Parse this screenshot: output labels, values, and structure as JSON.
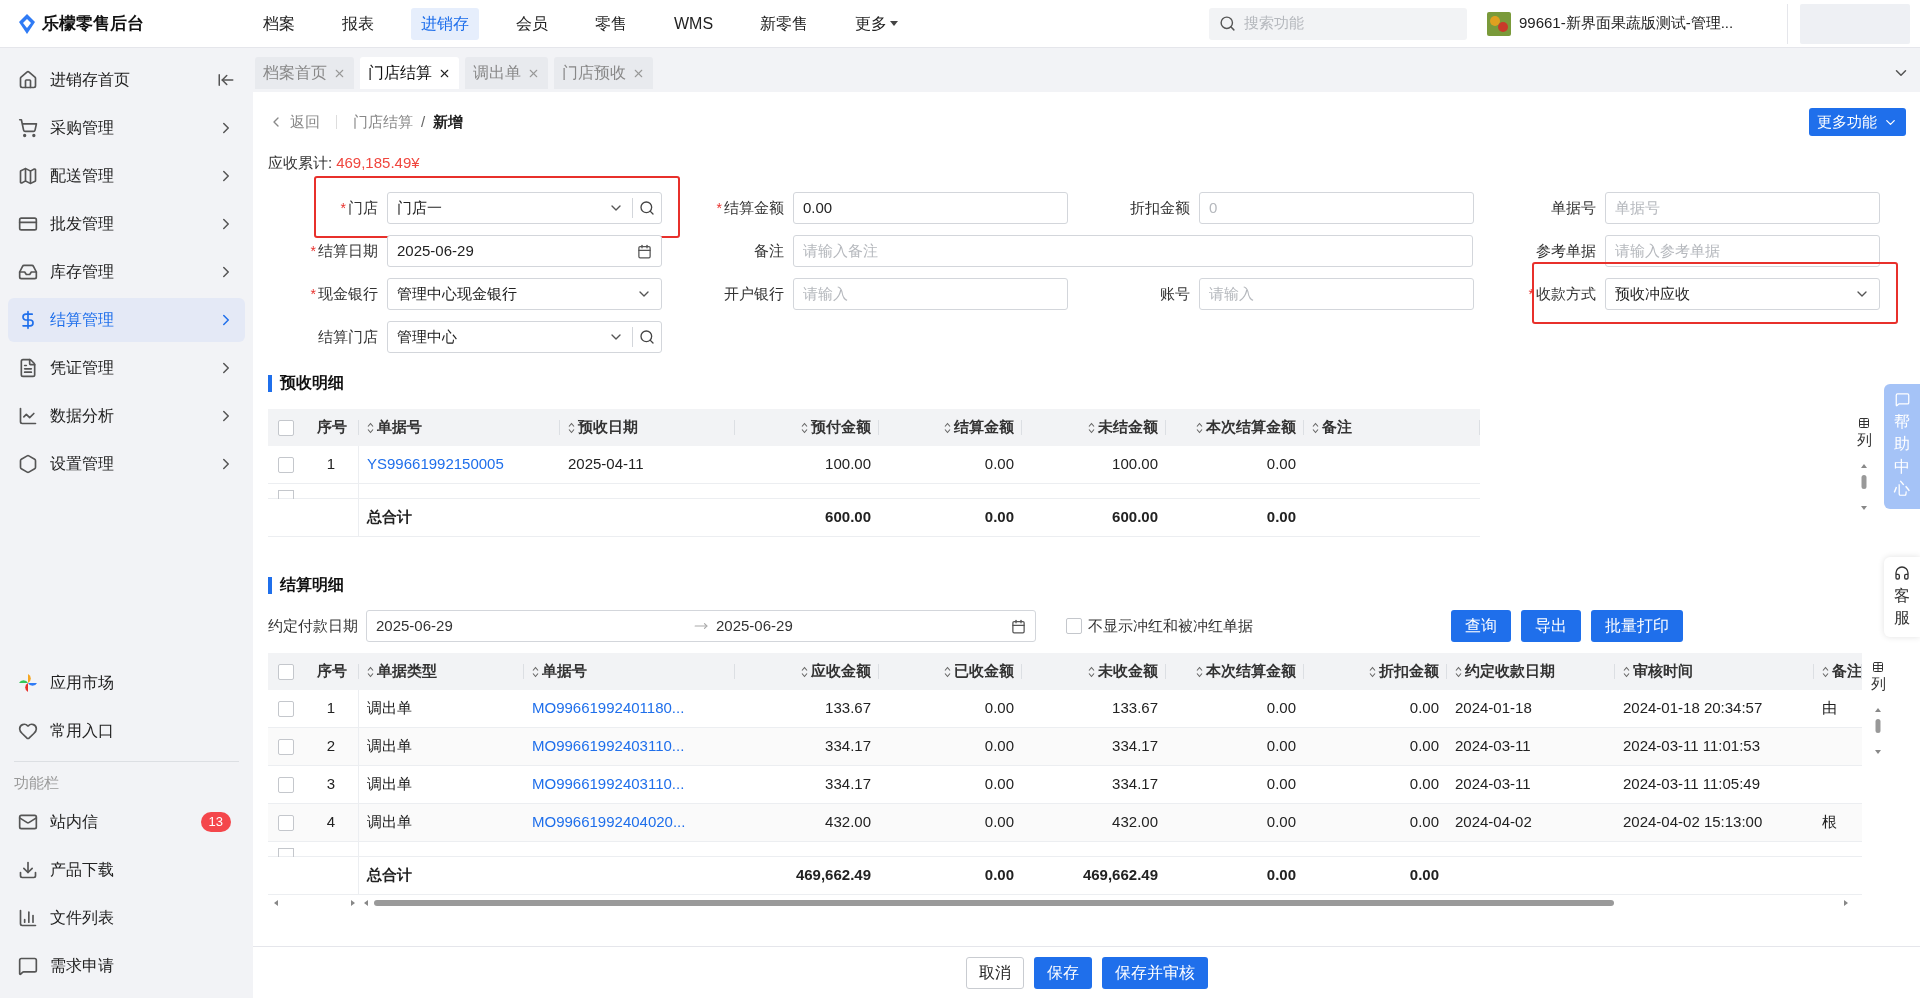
{
  "app": {
    "title": "乐檬零售后台"
  },
  "top_nav": [
    {
      "label": "档案",
      "selected": false,
      "dropdown": false
    },
    {
      "label": "报表",
      "selected": false,
      "dropdown": false
    },
    {
      "label": "进销存",
      "selected": true,
      "dropdown": false
    },
    {
      "label": "会员",
      "selected": false,
      "dropdown": false
    },
    {
      "label": "零售",
      "selected": false,
      "dropdown": false
    },
    {
      "label": "WMS",
      "selected": false,
      "dropdown": false
    },
    {
      "label": "新零售",
      "selected": false,
      "dropdown": false
    },
    {
      "label": "更多",
      "selected": false,
      "dropdown": true
    }
  ],
  "search": {
    "placeholder": "搜索功能"
  },
  "store": {
    "name": "99661-新界面果蔬版测试-管理..."
  },
  "sidebar": {
    "items": [
      {
        "label": "进销存首页",
        "selected": false,
        "expandable": false
      },
      {
        "label": "采购管理",
        "selected": false,
        "expandable": true
      },
      {
        "label": "配送管理",
        "selected": false,
        "expandable": true
      },
      {
        "label": "批发管理",
        "selected": false,
        "expandable": true
      },
      {
        "label": "库存管理",
        "selected": false,
        "expandable": true
      },
      {
        "label": "结算管理",
        "selected": true,
        "expandable": true
      },
      {
        "label": "凭证管理",
        "selected": false,
        "expandable": true
      },
      {
        "label": "数据分析",
        "selected": false,
        "expandable": true
      },
      {
        "label": "设置管理",
        "selected": false,
        "expandable": true
      }
    ],
    "shortcuts": [
      {
        "label": "应用市场"
      },
      {
        "label": "常用入口"
      }
    ],
    "section_title": "功能栏",
    "tools": [
      {
        "label": "站内信",
        "badge": "13"
      },
      {
        "label": "产品下载"
      },
      {
        "label": "文件列表"
      },
      {
        "label": "需求申请"
      }
    ]
  },
  "tabs": [
    {
      "label": "档案首页",
      "selected": false
    },
    {
      "label": "门店结算",
      "selected": true
    },
    {
      "label": "调出单",
      "selected": false
    },
    {
      "label": "门店预收",
      "selected": false
    }
  ],
  "breadcrumb": {
    "back": "返回",
    "path": [
      {
        "label": "门店结算",
        "current": false
      },
      {
        "label": "新增",
        "current": true
      }
    ],
    "separator": "/"
  },
  "more_button": {
    "label": "更多功能"
  },
  "receivable_total": {
    "label": "应收累计:",
    "value": "469,185.49¥"
  },
  "form": {
    "required_mark": "*",
    "fields": [
      {
        "label": "门店",
        "required": true,
        "kind": "select-search",
        "value": "门店一",
        "highlighted": true,
        "wide": false
      },
      {
        "label": "结算金额",
        "required": true,
        "kind": "text",
        "value": "0.00",
        "highlighted": false,
        "wide": false
      },
      {
        "label": "折扣金额",
        "required": false,
        "kind": "text",
        "placeholder": "0",
        "highlighted": false,
        "wide": false
      },
      {
        "label": "单据号",
        "required": false,
        "kind": "text",
        "placeholder": "单据号",
        "highlighted": false,
        "wide": false
      },
      {
        "label": "结算日期",
        "required": true,
        "kind": "date",
        "value": "2025-06-29",
        "highlighted": false,
        "wide": false
      },
      {
        "label": "备注",
        "required": false,
        "kind": "text",
        "placeholder": "请输入备注",
        "highlighted": false,
        "wide": true
      },
      {
        "label": "参考单据",
        "required": false,
        "kind": "text",
        "placeholder": "请输入参考单据",
        "highlighted": false,
        "wide": false
      },
      {
        "label": "现金银行",
        "required": true,
        "kind": "select",
        "value": "管理中心现金银行",
        "highlighted": false,
        "wide": false
      },
      {
        "label": "开户银行",
        "required": false,
        "kind": "text",
        "placeholder": "请输入",
        "highlighted": false,
        "wide": false
      },
      {
        "label": "账号",
        "required": false,
        "kind": "text",
        "placeholder": "请输入",
        "highlighted": false,
        "wide": false
      },
      {
        "label": "收款方式",
        "required": true,
        "kind": "select",
        "value": "预收冲应收",
        "highlighted": true,
        "wide": false
      },
      {
        "label": "结算门店",
        "required": false,
        "kind": "select-search",
        "value": "管理中心",
        "highlighted": false,
        "wide": false
      }
    ]
  },
  "prepaid_section": {
    "title": "预收明细",
    "column_settings": "列",
    "all_checked": false,
    "total_row": {
      "cells": [
        "",
        "总合计",
        "",
        "600.00",
        "0.00",
        "600.00",
        "0.00"
      ]
    },
    "columns": [
      {
        "label": "序号",
        "sortable": false,
        "kind": "index"
      },
      {
        "label": "单据号",
        "sortable": true,
        "kind": "link"
      },
      {
        "label": "预收日期",
        "sortable": true,
        "kind": "text"
      },
      {
        "label": "预付金额",
        "sortable": true,
        "kind": "number"
      },
      {
        "label": "结算金额",
        "sortable": true,
        "kind": "number"
      },
      {
        "label": "未结金额",
        "sortable": true,
        "kind": "number"
      },
      {
        "label": "本次结算金额",
        "sortable": true,
        "kind": "number"
      },
      {
        "label": "备注",
        "sortable": true,
        "kind": "text"
      }
    ],
    "rows": [
      {
        "checked": false,
        "cells": [
          "1",
          "YS99661992150005",
          "2025-04-11",
          "100.00",
          "0.00",
          "100.00",
          "0.00"
        ]
      }
    ]
  },
  "settlement_section": {
    "title": "结算明细",
    "column_settings": "列",
    "all_checked": false,
    "total_row": {
      "cells": [
        "",
        "总合计",
        "",
        "469,662.49",
        "0.00",
        "469,662.49",
        "0.00",
        "0.00"
      ]
    },
    "filter": {
      "label": "约定付款日期",
      "start": "2025-06-29",
      "end": "2025-06-29",
      "checkbox": {
        "label": "不显示冲红和被冲红单据",
        "checked": false
      },
      "buttons": [
        {
          "label": "查询"
        },
        {
          "label": "导出"
        },
        {
          "label": "批量打印"
        }
      ]
    },
    "columns": [
      {
        "label": "序号",
        "sortable": false,
        "kind": "index"
      },
      {
        "label": "单据类型",
        "sortable": true,
        "kind": "text"
      },
      {
        "label": "单据号",
        "sortable": true,
        "kind": "link"
      },
      {
        "label": "应收金额",
        "sortable": true,
        "kind": "number"
      },
      {
        "label": "已收金额",
        "sortable": true,
        "kind": "number"
      },
      {
        "label": "未收金额",
        "sortable": true,
        "kind": "number"
      },
      {
        "label": "本次结算金额",
        "sortable": true,
        "kind": "number"
      },
      {
        "label": "折扣金额",
        "sortable": true,
        "kind": "number"
      },
      {
        "label": "约定收款日期",
        "sortable": true,
        "kind": "text"
      },
      {
        "label": "审核时间",
        "sortable": true,
        "kind": "text"
      },
      {
        "label": "备注",
        "sortable": true,
        "kind": "text"
      }
    ],
    "rows": [
      {
        "checked": false,
        "cells": [
          "1",
          "调出单",
          "MO99661992401180...",
          "133.67",
          "0.00",
          "133.67",
          "0.00",
          "0.00",
          "2024-01-18",
          "2024-01-18 20:34:57",
          "由"
        ]
      },
      {
        "checked": false,
        "cells": [
          "2",
          "调出单",
          "MO99661992403110...",
          "334.17",
          "0.00",
          "334.17",
          "0.00",
          "0.00",
          "2024-03-11",
          "2024-03-11 11:01:53"
        ]
      },
      {
        "checked": false,
        "cells": [
          "3",
          "调出单",
          "MO99661992403110...",
          "334.17",
          "0.00",
          "334.17",
          "0.00",
          "0.00",
          "2024-03-11",
          "2024-03-11 11:05:49"
        ]
      },
      {
        "checked": false,
        "cells": [
          "4",
          "调出单",
          "MO99661992404020...",
          "432.00",
          "0.00",
          "432.00",
          "0.00",
          "0.00",
          "2024-04-02",
          "2024-04-02 15:13:00",
          "根"
        ]
      }
    ]
  },
  "side_widgets": [
    {
      "label": "帮助中心",
      "kind": "help"
    },
    {
      "label": "客服",
      "kind": "service"
    }
  ],
  "footer_buttons": [
    {
      "label": "取消",
      "kind": "default"
    },
    {
      "label": "保存",
      "kind": "primary"
    },
    {
      "label": "保存并审核",
      "kind": "primary"
    }
  ]
}
